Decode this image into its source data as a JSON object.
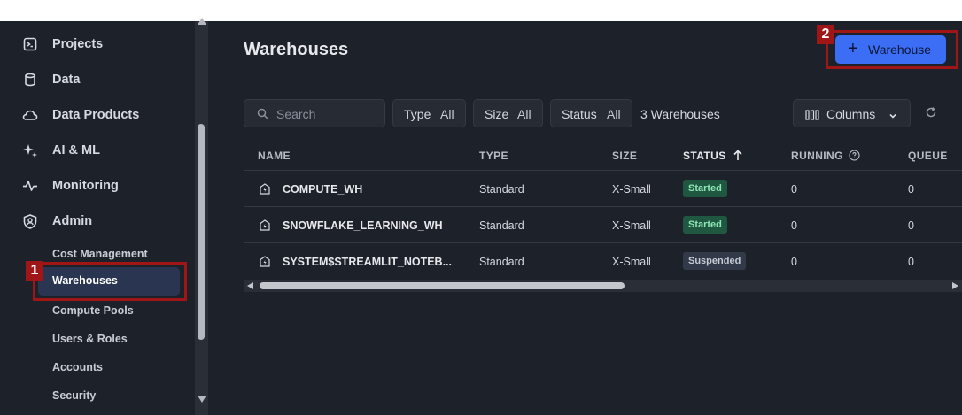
{
  "sidebar": {
    "nav": [
      {
        "label": "Projects",
        "icon": "terminal-icon"
      },
      {
        "label": "Data",
        "icon": "database-icon"
      },
      {
        "label": "Data Products",
        "icon": "cloud-icon"
      },
      {
        "label": "AI & ML",
        "icon": "sparkle-icon"
      },
      {
        "label": "Monitoring",
        "icon": "activity-icon"
      },
      {
        "label": "Admin",
        "icon": "shield-user-icon"
      }
    ],
    "admin_items": [
      "Cost Management",
      "Warehouses",
      "Compute Pools",
      "Users & Roles",
      "Accounts",
      "Security"
    ],
    "active_item": "Warehouses"
  },
  "main": {
    "title": "Warehouses",
    "add_button_label": "Warehouse",
    "search_placeholder": "Search",
    "filters": [
      {
        "key": "Type",
        "value": "All"
      },
      {
        "key": "Size",
        "value": "All"
      },
      {
        "key": "Status",
        "value": "All"
      }
    ],
    "count_text": "3 Warehouses",
    "columns_label": "Columns",
    "table": {
      "headers": [
        "NAME",
        "TYPE",
        "SIZE",
        "STATUS",
        "RUNNING",
        "QUEUE"
      ],
      "sort_column": "STATUS",
      "rows": [
        {
          "name": "COMPUTE_WH",
          "type": "Standard",
          "size": "X-Small",
          "status": "Started",
          "running": "0",
          "queued": "0"
        },
        {
          "name": "SNOWFLAKE_LEARNING_WH",
          "type": "Standard",
          "size": "X-Small",
          "status": "Started",
          "running": "0",
          "queued": "0"
        },
        {
          "name": "SYSTEM$STREAMLIT_NOTEB...",
          "type": "Standard",
          "size": "X-Small",
          "status": "Suspended",
          "running": "0",
          "queued": "0"
        }
      ]
    }
  },
  "annotations": {
    "badge_1": "1",
    "badge_2": "2"
  },
  "colors": {
    "background": "#1d2129",
    "accent": "#3b6ef5",
    "highlight": "#a01616",
    "started_pill": "#1f5740",
    "suspended_pill": "#323948"
  }
}
